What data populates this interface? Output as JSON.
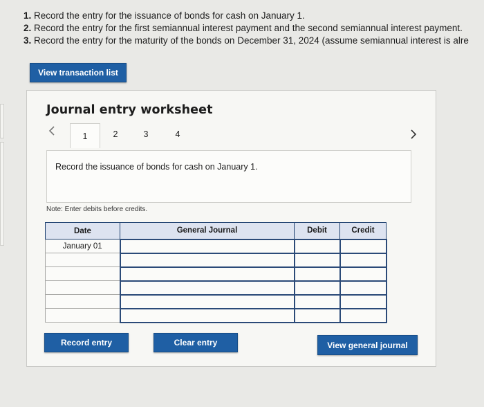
{
  "instructions": [
    {
      "num": "1.",
      "text": "Record the entry for the issuance of bonds for cash on January 1."
    },
    {
      "num": "2.",
      "text": "Record the entry for the first semiannual interest payment and the second semiannual interest payment."
    },
    {
      "num": "3.",
      "text": "Record the entry for the maturity of the bonds on December 31, 2024 (assume semiannual interest is alre"
    }
  ],
  "view_transaction_list": "View transaction list",
  "worksheet": {
    "title": "Journal entry worksheet",
    "prev_icon": "chevron-left-icon",
    "next_icon": "chevron-right-icon",
    "tabs": [
      "1",
      "2",
      "3",
      "4"
    ],
    "active_tab": "1",
    "description": "Record the issuance of bonds for cash on January 1.",
    "note": "Note: Enter debits before credits.",
    "table": {
      "headers": [
        "Date",
        "General Journal",
        "Debit",
        "Credit"
      ],
      "rows": [
        {
          "date": "January 01",
          "account": "",
          "debit": "",
          "credit": ""
        },
        {
          "date": "",
          "account": "",
          "debit": "",
          "credit": ""
        },
        {
          "date": "",
          "account": "",
          "debit": "",
          "credit": ""
        },
        {
          "date": "",
          "account": "",
          "debit": "",
          "credit": ""
        },
        {
          "date": "",
          "account": "",
          "debit": "",
          "credit": ""
        },
        {
          "date": "",
          "account": "",
          "debit": "",
          "credit": ""
        }
      ]
    },
    "buttons": {
      "record": "Record entry",
      "clear": "Clear entry",
      "view_general_journal": "View general journal"
    }
  },
  "colors": {
    "button_blue": "#1f5fa4",
    "header_fill": "#dde3f0",
    "grid_border": "#2b4a78"
  }
}
